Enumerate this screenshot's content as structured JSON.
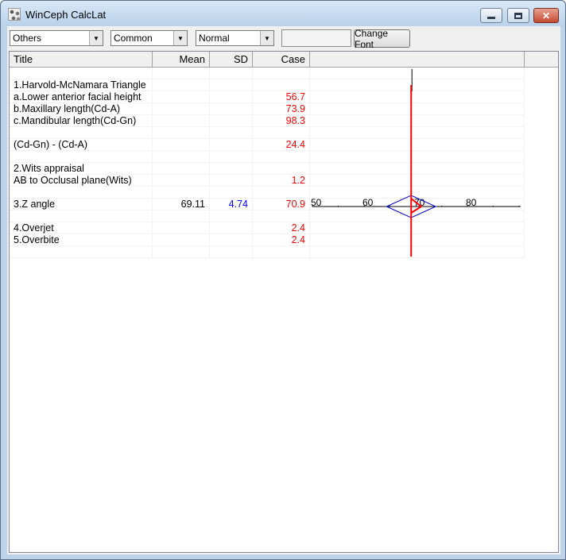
{
  "window": {
    "title": "WinCeph CalcLat",
    "minimize_glyph": "",
    "close_glyph": "✕"
  },
  "toolbar": {
    "combo_1": "Others",
    "combo_2": "Common",
    "combo_3": "Normal",
    "text_value": "",
    "change_font_label": "Change Font"
  },
  "table": {
    "headers": {
      "title": "Title",
      "mean": "Mean",
      "sd": "SD",
      "case": "Case"
    },
    "rows": [
      {
        "title": "",
        "mean": "",
        "sd": "",
        "case": ""
      },
      {
        "title": "1.Harvold-McNamara Triangle",
        "mean": "",
        "sd": "",
        "case": ""
      },
      {
        "title": "a.Lower anterior facial height",
        "mean": "",
        "sd": "",
        "case": "56.7"
      },
      {
        "title": "b.Maxillary length(Cd-A)",
        "mean": "",
        "sd": "",
        "case": "73.9"
      },
      {
        "title": "c.Mandibular length(Cd-Gn)",
        "mean": "",
        "sd": "",
        "case": "98.3"
      },
      {
        "title": "",
        "mean": "",
        "sd": "",
        "case": ""
      },
      {
        "title": "(Cd-Gn) - (Cd-A)",
        "mean": "",
        "sd": "",
        "case": "24.4"
      },
      {
        "title": "",
        "mean": "",
        "sd": "",
        "case": ""
      },
      {
        "title": "2.Wits appraisal",
        "mean": "",
        "sd": "",
        "case": ""
      },
      {
        "title": "AB to Occlusal plane(Wits)",
        "mean": "",
        "sd": "",
        "case": "1.2"
      },
      {
        "title": "",
        "mean": "",
        "sd": "",
        "case": ""
      },
      {
        "title": "3.Z angle",
        "mean": "69.11",
        "sd": "4.74",
        "case": "70.9"
      },
      {
        "title": "",
        "mean": "",
        "sd": "",
        "case": ""
      },
      {
        "title": "4.Overjet",
        "mean": "",
        "sd": "",
        "case": "2.4"
      },
      {
        "title": "5.Overbite",
        "mean": "",
        "sd": "",
        "case": "2.4"
      },
      {
        "title": "",
        "mean": "",
        "sd": "",
        "case": ""
      }
    ]
  },
  "chart_data": {
    "type": "scatter",
    "scale_ticks": [
      50,
      60,
      70,
      80
    ],
    "scale_tick_labels": [
      "50",
      "60",
      "70",
      "80"
    ],
    "xlim": [
      50,
      70
    ],
    "mean": 69.11,
    "sd": 4.74,
    "case": 70.9,
    "colors": {
      "mean": "#ff0000",
      "case": "#ff0000",
      "sd_diamond": "#0000cc",
      "axis": "#000000"
    }
  }
}
